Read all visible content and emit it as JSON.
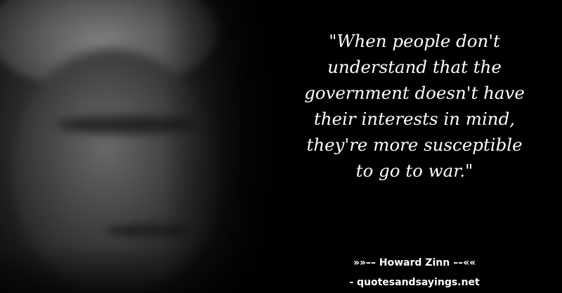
{
  "quote": {
    "lines": [
      "\"When people don't",
      "understand that the",
      "government doesn't have",
      "their interests in mind,",
      "they're more susceptible",
      "to go to war.\""
    ]
  },
  "author_line": "»»–– Howard Zinn ––««",
  "source_line": "- quotesandsayings.net",
  "colors": {
    "background": "#000000",
    "text": "#ffffff"
  }
}
